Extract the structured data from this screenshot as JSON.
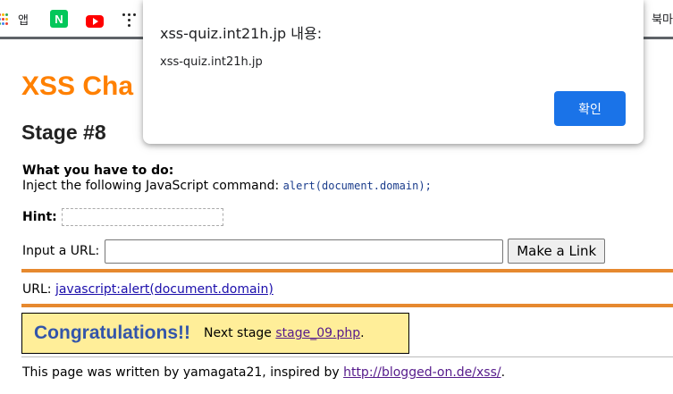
{
  "bookmarks": {
    "apps_label": "앱",
    "naver_letter": "N",
    "right_label": "북마",
    "apps_dot_colors": [
      "#ea4335",
      "#fbbc04",
      "#34a853",
      "#4285f4",
      "#ea4335",
      "#fbbc04",
      "#34a853",
      "#4285f4",
      "#ea4335"
    ]
  },
  "page": {
    "title": "XSS Cha",
    "stage": "Stage #8",
    "task_heading": "What you have to do:",
    "task_text": "Inject the following JavaScript command:",
    "task_code": "alert(document.domain);",
    "hint_label": "Hint:",
    "input_label": "Input a URL:",
    "input_value": "",
    "make_link_button": "Make a Link",
    "url_label": "URL:",
    "url_link": "javascript:alert(document.domain)",
    "congrats": "Congratulations!!",
    "next_stage_text": "Next stage",
    "next_stage_link": "stage_09.php",
    "next_stage_suffix": ".",
    "footer_text": "This page was written by yamagata21, inspired by",
    "footer_link": "http://blogged-on.de/xss/",
    "footer_suffix": "."
  },
  "dialog": {
    "title": "xss-quiz.int21h.jp 내용:",
    "message": "xss-quiz.int21h.jp",
    "ok_button": "확인"
  },
  "colors": {
    "title_orange": "#ff8000",
    "rule_orange": "#e6892f",
    "congrats_bg": "#ffee99",
    "congrats_text": "#3355aa",
    "dialog_button": "#1a73e8"
  }
}
